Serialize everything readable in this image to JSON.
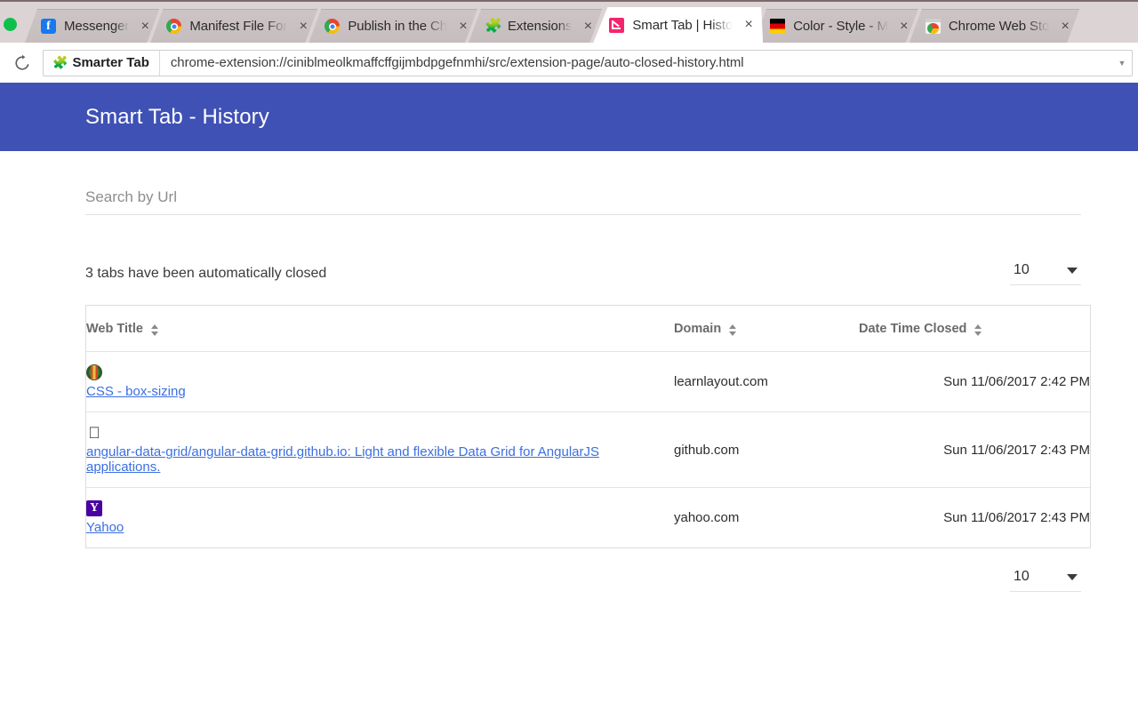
{
  "browser": {
    "reload_icon": "reload-icon",
    "tabs": [
      {
        "title": "Messenger",
        "favicon": "messenger-icon",
        "active": false,
        "close_label": "×"
      },
      {
        "title": "Manifest File For",
        "favicon": "chrome-icon",
        "active": false,
        "close_label": "×"
      },
      {
        "title": "Publish in the Ch",
        "favicon": "chrome-icon",
        "active": false,
        "close_label": "×"
      },
      {
        "title": "Extensions",
        "favicon": "puzzle-icon",
        "active": false,
        "close_label": "×"
      },
      {
        "title": "Smart Tab | Histo",
        "favicon": "smart-tab-icon",
        "active": true,
        "close_label": "×"
      },
      {
        "title": "Color - Style - M",
        "favicon": "germany-flag-icon",
        "active": false,
        "close_label": "×"
      },
      {
        "title": "Chrome Web Sto",
        "favicon": "chrome-webstore-icon",
        "active": false,
        "close_label": "×"
      }
    ],
    "omnibox": {
      "badge_label": "Smarter Tab",
      "badge_icon": "puzzle-icon",
      "url": "chrome-extension://ciniblmeolkmaffcffgijmbdpgefnmhi/src/extension-page/auto-closed-history.html",
      "dropdown_icon": "chevron-down-icon"
    }
  },
  "app": {
    "header": {
      "title": "Smart Tab - History",
      "background_color": "#3f51b5",
      "text_color": "#ffffff"
    },
    "search": {
      "placeholder": "Search by Url",
      "value": ""
    },
    "summary": {
      "text": "3 tabs have been automatically closed"
    },
    "page_size_top": {
      "value": "10",
      "caret_icon": "chevron-down-icon"
    },
    "page_size_bottom": {
      "value": "10",
      "caret_icon": "chevron-down-icon"
    },
    "table": {
      "columns": [
        {
          "label": "Web Title",
          "sort_icon": "sort-icon"
        },
        {
          "label": "Domain",
          "sort_icon": "sort-icon"
        },
        {
          "label": "Date Time Closed",
          "sort_icon": "sort-icon"
        }
      ],
      "rows": [
        {
          "favicon": "learnlayout-icon",
          "title": "CSS - box-sizing",
          "domain": "learnlayout.com",
          "date_closed": "Sun 11/06/2017 2:42 PM"
        },
        {
          "favicon": "github-icon",
          "title": "angular-data-grid/angular-data-grid.github.io: Light and flexible Data Grid for AngularJS applications.",
          "domain": "github.com",
          "date_closed": "Sun 11/06/2017 2:43 PM"
        },
        {
          "favicon": "yahoo-icon",
          "title": "Yahoo",
          "domain": "yahoo.com",
          "date_closed": "Sun 11/06/2017 2:43 PM"
        }
      ]
    },
    "link_color": "#3b6fe0"
  }
}
